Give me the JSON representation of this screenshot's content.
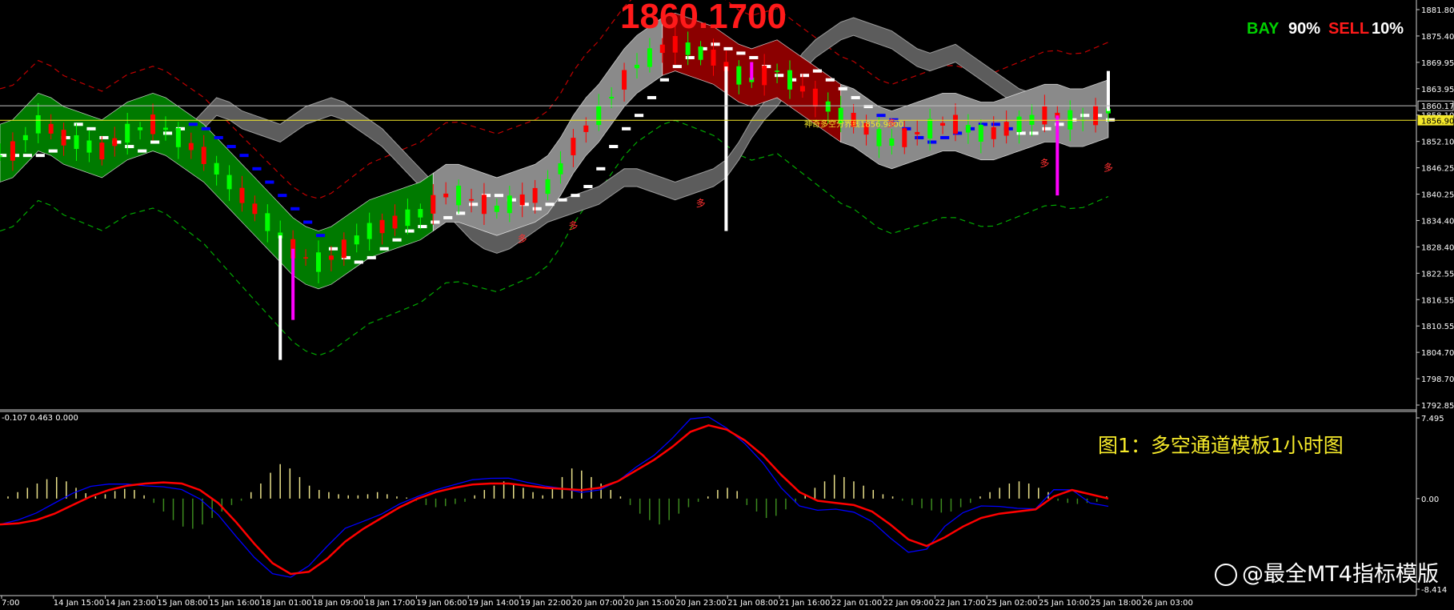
{
  "header": {
    "big_price": "1860.1700",
    "bay_label": "BAY",
    "bay_pct": "90%",
    "sell_label": "SELL",
    "sell_pct": "10%"
  },
  "caption": "图1：多空通道模板1小时图",
  "watermark": "@最全MT4指标模版",
  "indicator_header": "-0.107 0.463 0.000",
  "price_line_label": "神奇多空分界线1856.9000",
  "signal_marker": "多",
  "colors": {
    "bull_candle": "#00ff00",
    "bear_candle": "#ff0000",
    "channel_green": "#007a00",
    "channel_red": "#8b0000",
    "channel_gray": "#8a8a8a",
    "trend_blue": "#0000ff",
    "trend_white": "#ffffff",
    "outer_red": "#c00000",
    "outer_green": "#00aa00",
    "level_yellow": "#f5e92a",
    "macd_red": "#ff0000",
    "macd_blue": "#0000ff"
  },
  "chart_data": [
    {
      "type": "line",
      "title": "",
      "y_ticks": [
        "1881.80",
        "1875.40",
        "1869.95",
        "1863.95",
        "1858.10",
        "1852.10",
        "1846.25",
        "1840.25",
        "1834.40",
        "1828.40",
        "1822.55",
        "1816.55",
        "1810.55",
        "1804.70",
        "1798.70",
        "1792.85"
      ],
      "y_price_labels": [
        "1860.17",
        "1856.90"
      ],
      "ylim": [
        1792.85,
        1881.8
      ],
      "x_ticks": [
        "7:00",
        "14 Jan 15:00",
        "14 Jan 23:00",
        "15 Jan 08:00",
        "15 Jan 16:00",
        "18 Jan 01:00",
        "18 Jan 09:00",
        "18 Jan 17:00",
        "19 Jan 06:00",
        "19 Jan 14:00",
        "19 Jan 22:00",
        "20 Jan 07:00",
        "20 Jan 15:00",
        "20 Jan 23:00",
        "21 Jan 08:00",
        "21 Jan 16:00",
        "22 Jan 01:00",
        "22 Jan 09:00",
        "22 Jan 17:00",
        "25 Jan 02:00",
        "25 Jan 10:00",
        "25 Jan 18:00",
        "26 Jan 03:00"
      ],
      "series": [
        {
          "name": "",
          "values": [
            1849,
            1850,
            1853,
            1856,
            1855,
            1853,
            1852,
            1851,
            1850,
            1852,
            1854,
            1855,
            1856,
            1855,
            1853,
            1851,
            1849,
            1846,
            1843,
            1840,
            1837,
            1834,
            1831,
            1828,
            1826,
            1825,
            1826,
            1828,
            1830,
            1832,
            1833,
            1834,
            1835,
            1836,
            1838,
            1840,
            1840,
            1839,
            1838,
            1837,
            1838,
            1839,
            1840,
            1842,
            1846,
            1851,
            1855,
            1858,
            1862,
            1866,
            1869,
            1871,
            1873,
            1874,
            1873,
            1872,
            1871,
            1869,
            1867,
            1866,
            1867,
            1868,
            1866,
            1864,
            1862,
            1860,
            1858,
            1857,
            1855,
            1853,
            1852,
            1853,
            1854,
            1855,
            1856,
            1856,
            1855,
            1854,
            1854,
            1855,
            1856,
            1857,
            1858,
            1858,
            1857,
            1857,
            1858,
            1859
          ]
        }
      ],
      "levels": [
        1860.17,
        1856.9
      ]
    },
    {
      "type": "bar",
      "title": "",
      "ylim": [
        -8.414,
        7.495
      ],
      "y_ticks": [
        "7.495",
        "0.00",
        "-8.414"
      ],
      "series": [
        {
          "name": "",
          "values": [
            0.2,
            0.6,
            1.0,
            1.4,
            1.8,
            2.0,
            1.6,
            1.0,
            0.5,
            0.2,
            0.4,
            0.7,
            0.9,
            0.8,
            0.3,
            -0.4,
            -1.2,
            -2.0,
            -2.6,
            -2.8,
            -2.4,
            -1.8,
            -1.2,
            -0.6,
            -0.2,
            0.6,
            1.4,
            2.4,
            3.2,
            2.8,
            2.0,
            1.2,
            0.8,
            0.6,
            0.4,
            0.3,
            0.3,
            0.4,
            0.6,
            0.4,
            0.2,
            0.1,
            -0.2,
            -0.6,
            -0.8,
            -0.7,
            -0.5,
            -0.3,
            0.3,
            0.8,
            1.2,
            1.6,
            1.4,
            1.0,
            0.6,
            0.3,
            1.0,
            2.0,
            2.8,
            2.6,
            2.0,
            1.4,
            0.8,
            0.2,
            -0.6,
            -1.4,
            -2.0,
            -2.4,
            -2.0,
            -1.4,
            -0.8,
            -0.3,
            0.2,
            0.8,
            1.0,
            0.7,
            -0.6,
            -1.2,
            -1.8,
            -1.6,
            -1.0,
            -0.4,
            0.3,
            1.0,
            1.6,
            2.2,
            2.0,
            1.6,
            1.2,
            0.8,
            0.4,
            0.2,
            -0.2,
            -0.6,
            -0.9,
            -1.1,
            -1.3,
            -1.2,
            -0.8,
            -0.4,
            0.2,
            0.6,
            1.0,
            1.4,
            1.6,
            1.4,
            1.0,
            0.6,
            -0.2,
            -0.4,
            -0.5,
            -0.4,
            -0.3,
            0.2
          ]
        },
        {
          "name": "",
          "values": [
            -2.4,
            -2.3,
            -2.0,
            -1.4,
            -0.6,
            0.2,
            0.8,
            1.2,
            1.4,
            1.5,
            1.4,
            0.8,
            -0.4,
            -2.2,
            -4.2,
            -6.0,
            -7.0,
            -6.8,
            -5.6,
            -4.0,
            -2.8,
            -1.8,
            -0.8,
            0.0,
            0.6,
            1.0,
            1.3,
            1.4,
            1.4,
            1.2,
            1.0,
            0.9,
            0.8,
            1.0,
            1.6,
            2.6,
            3.6,
            4.8,
            6.2,
            6.8,
            6.4,
            5.4,
            4.0,
            2.2,
            0.6,
            -0.2,
            -0.4,
            -0.6,
            -1.2,
            -2.4,
            -3.8,
            -4.4,
            -3.6,
            -2.6,
            -1.8,
            -1.4,
            -1.2,
            -1.0,
            0.2,
            0.8,
            0.4,
            0.0
          ]
        }
      ]
    }
  ]
}
